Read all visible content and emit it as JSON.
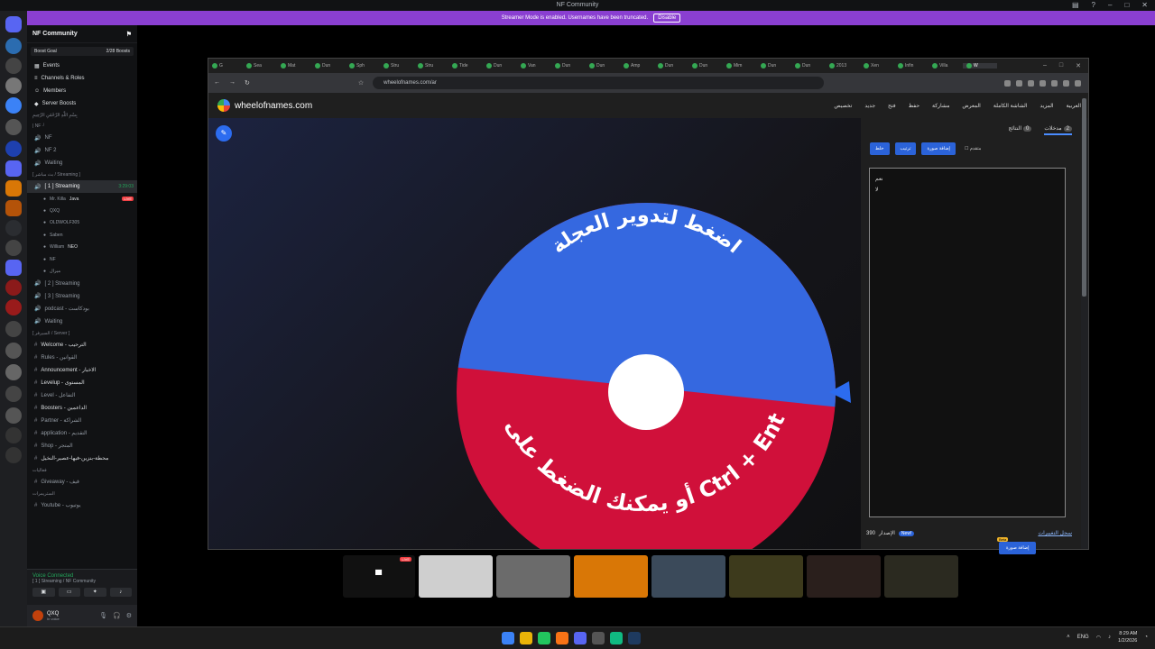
{
  "window": {
    "title": "NF Community"
  },
  "banner": {
    "text": "Streamer Mode is enabled. Usernames have been truncated.",
    "button": "Disable"
  },
  "guild": {
    "name": "NF Community"
  },
  "boost": {
    "label": "Boost Goal",
    "value": "2/28 Boosts"
  },
  "nav": [
    "Events",
    "Channels & Roles",
    "Members",
    "Server Boosts"
  ],
  "channels": [
    {
      "text": "بِسْمِ اللَّهِ الرَّحْمَٰنِ الرَّحِيمِ",
      "kind": "cat"
    },
    {
      "text": "| NF ┘",
      "kind": "cat"
    },
    {
      "text": "NF",
      "kind": "voice"
    },
    {
      "text": "NF 2",
      "kind": "voice"
    },
    {
      "text": "Waiting",
      "kind": "voice"
    },
    {
      "text": "[ بث مباشر / Streaming ]",
      "kind": "cat"
    },
    {
      "text": "[ 1 ] Streaming",
      "kind": "voice",
      "selected": true,
      "time": "3:29:03"
    }
  ],
  "voice_users": [
    {
      "name": "Mr. Killa",
      "tag": "Java",
      "live": "LIVE"
    },
    {
      "name": "QXQ"
    },
    {
      "name": "OLDWOLF305"
    },
    {
      "name": "Saben"
    },
    {
      "name": "William",
      "tag": "NEO"
    },
    {
      "name": "NF"
    },
    {
      "name": "ميرال"
    }
  ],
  "channels2": [
    {
      "text": "[ 2 ] Streaming",
      "kind": "voice"
    },
    {
      "text": "[ 3 ] Streaming",
      "kind": "voice"
    },
    {
      "text": "podcast - بودكاست",
      "kind": "voice"
    },
    {
      "text": "Waiting",
      "kind": "voice"
    },
    {
      "text": "[ السيرفر / Server ]",
      "kind": "cat"
    },
    {
      "text": "Welcome - الترحيب",
      "kind": "text",
      "bright": true
    },
    {
      "text": "Rules - القوانين",
      "kind": "text"
    },
    {
      "text": "Announcement - الاخبار",
      "kind": "text",
      "bright": true
    },
    {
      "text": "Levelup - المستوى",
      "kind": "text",
      "bright": true
    },
    {
      "text": "Level - التفاعل",
      "kind": "text"
    },
    {
      "text": "Boosters - الداعمين",
      "kind": "text",
      "bright": true
    },
    {
      "text": "Partner - الشراكة",
      "kind": "text"
    },
    {
      "text": "application - التقديم",
      "kind": "text"
    },
    {
      "text": "Shop - المتجر",
      "kind": "text"
    },
    {
      "text": "محطة-بنزين-فيها-عصير-النخيل",
      "kind": "text",
      "bright": true
    },
    {
      "text": "فعاليات",
      "kind": "cat"
    },
    {
      "text": "Giveaway - قيف",
      "kind": "text"
    },
    {
      "text": "الستريمرات",
      "kind": "cat"
    },
    {
      "text": "Youtube - يوتيوب",
      "kind": "text"
    }
  ],
  "voice_panel": {
    "status": "Voice Connected",
    "channel": "[ 1 ] Streaming / NF Community"
  },
  "user": {
    "name": "QXQ",
    "status": "In voice"
  },
  "browser": {
    "tabs": [
      "G",
      "Sea",
      "Mat",
      "Dun",
      "Sph",
      "Stru",
      "Stru",
      "Tide",
      "Dun",
      "Van",
      "Dun",
      "Dun",
      "Amp",
      "Dun",
      "Dun",
      "Mim",
      "Dun",
      "Dun",
      "2013",
      "Xen",
      "Infin",
      "Villa",
      "W"
    ],
    "url": "wheelofnames.com/ar",
    "site": "wheelofnames.com",
    "menu": [
      "تخصيص",
      "جديد",
      "فتح",
      "حفظ",
      "مشاركة",
      "المعرض",
      "الشاشة الكاملة",
      "المزيد",
      "العربية"
    ]
  },
  "wheel": {
    "top_text": "اضغط لتدوير العجلة",
    "bottom_text": "أو يمكنك الضغط على زر Ctrl + Enter",
    "colors": {
      "top": "#3568e0",
      "bottom": "#d0103a"
    }
  },
  "panel": {
    "tab_entries": "مدخلات",
    "entries_count": "2",
    "tab_results": "النتائج",
    "results_count": "0",
    "tools": [
      "خلط",
      "ترتيب",
      "إضافة صورة"
    ],
    "advanced": "متقدم",
    "entries": [
      "نعم",
      "لا"
    ],
    "add_button": "إضافة صورة",
    "beta": "Beta",
    "version": "390",
    "version_label": "الإصدار",
    "new_badge": "New!",
    "changelog": "سجل التغييرات"
  },
  "taskbar": {
    "lang": "ENG",
    "time": "8:29 AM",
    "date": "1/2/2026"
  }
}
